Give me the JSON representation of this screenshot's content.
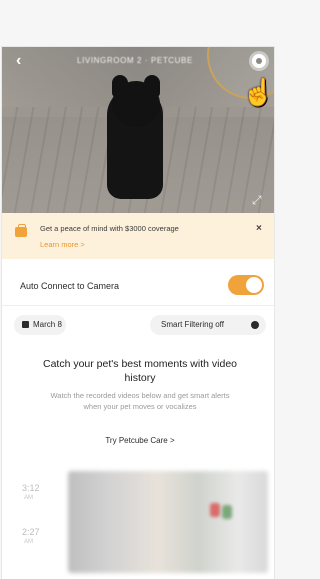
{
  "camera": {
    "title": "LIVINGROOM 2 · PETCUBE"
  },
  "icons": {
    "back": "‹",
    "settings": "settings-icon",
    "expand": "⤢",
    "close": "×",
    "hand": "☝"
  },
  "promo": {
    "text": "Get a peace of mind with $3000 coverage",
    "link": "Learn more >"
  },
  "settings_rows": {
    "auto_connect_label": "Auto Connect to Camera",
    "auto_connect_on": true
  },
  "filters": {
    "date_label": "March 8",
    "smart_filtering_label": "Smart Filtering off"
  },
  "history": {
    "title": "Catch your pet's best moments with video history",
    "description": "Watch the recorded videos below and get smart alerts when your pet moves or vocalizes",
    "try_link": "Try Petcube Care  >"
  },
  "timeline": {
    "entries": [
      {
        "time": "3:12",
        "sub": "AM"
      },
      {
        "time": "2:27",
        "sub": "AM"
      }
    ]
  },
  "colors": {
    "accent": "#f0a23b",
    "promo_bg": "#fdf1dc",
    "highlight_ring": "#c9a35a"
  }
}
